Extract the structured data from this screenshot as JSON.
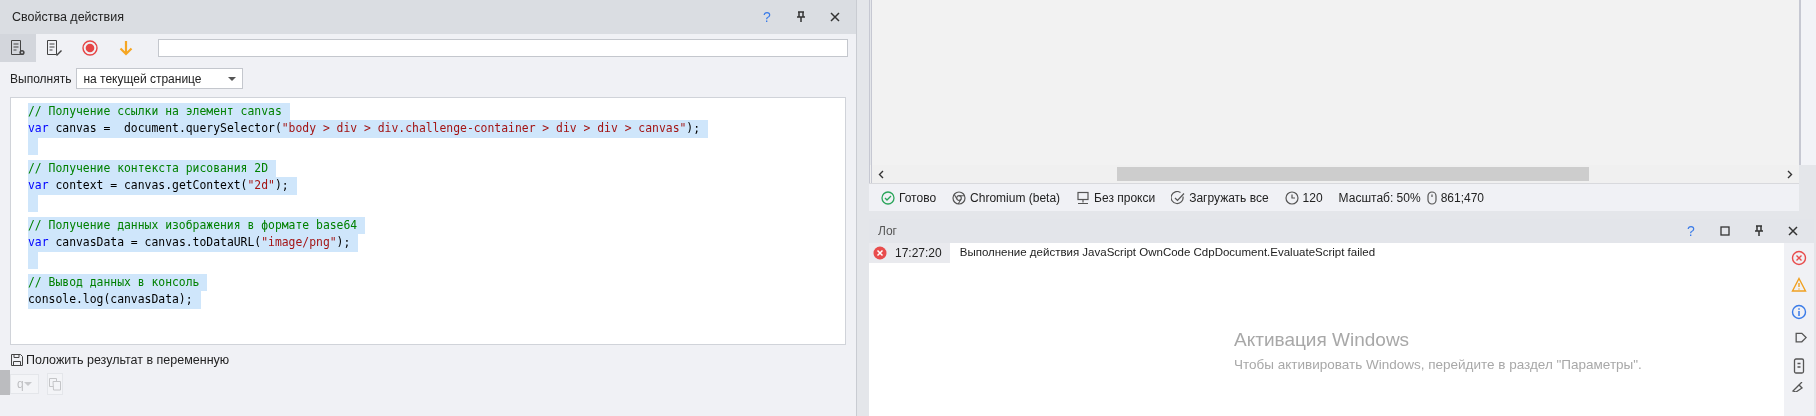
{
  "action_panel": {
    "title": "Свойства действия",
    "header_buttons": [
      {
        "kind": "help",
        "text": "?"
      },
      {
        "kind": "pin"
      },
      {
        "kind": "close"
      }
    ],
    "toolbar": [
      {
        "kind": "settings",
        "selected": true
      },
      {
        "kind": "edit",
        "selected": false
      },
      {
        "kind": "record",
        "selected": false
      },
      {
        "kind": "down",
        "selected": false
      }
    ],
    "execute_label": "Выполнять",
    "execute_value": "на текущей странице",
    "code_lines": [
      {
        "selected": true,
        "tokens": [
          {
            "kind": "comment",
            "text": "// Получение ссылки на элемент canvas"
          }
        ]
      },
      {
        "selected": true,
        "tokens": [
          {
            "kind": "keyword",
            "text": "var"
          },
          {
            "kind": "plain",
            "text": " canvas =  document.querySelector("
          },
          {
            "kind": "string",
            "text": "\"body > div > div.challenge-container > div > div > canvas\""
          },
          {
            "kind": "plain",
            "text": ");"
          }
        ]
      },
      {
        "selected": true
      },
      {
        "selected": true,
        "tokens": [
          {
            "kind": "comment",
            "text": "// Получение контекста рисования 2D"
          }
        ]
      },
      {
        "selected": true,
        "tokens": [
          {
            "kind": "keyword",
            "text": "var"
          },
          {
            "kind": "plain",
            "text": " context = canvas.getContext("
          },
          {
            "kind": "string",
            "text": "\"2d\""
          },
          {
            "kind": "plain",
            "text": ");"
          }
        ]
      },
      {
        "selected": true
      },
      {
        "selected": true,
        "tokens": [
          {
            "kind": "comment",
            "text": "// Получение данных изображения в формате base64"
          }
        ]
      },
      {
        "selected": true,
        "tokens": [
          {
            "kind": "keyword",
            "text": "var"
          },
          {
            "kind": "plain",
            "text": " canvasData = canvas.toDataURL("
          },
          {
            "kind": "string",
            "text": "\"image/png\""
          },
          {
            "kind": "plain",
            "text": ");"
          }
        ]
      },
      {
        "selected": true
      },
      {
        "selected": true,
        "tokens": [
          {
            "kind": "comment",
            "text": "// Вывод данных в консоль"
          }
        ]
      },
      {
        "selected": true,
        "tokens": [
          {
            "kind": "plain",
            "text": "console.log(canvasData);"
          }
        ]
      }
    ],
    "save_label": "Положить результат в переменную",
    "variable_value": "q"
  },
  "status_bar": [
    {
      "kind": "ready",
      "text": "Готово"
    },
    {
      "kind": "browser",
      "text": "Chromium (beta)"
    },
    {
      "kind": "proxy",
      "text": "Без прокси"
    },
    {
      "kind": "load",
      "text": "Загружать все"
    },
    {
      "kind": "timeout",
      "text": "120"
    },
    {
      "kind": "zoom",
      "text": "Масштаб: 50%"
    },
    {
      "kind": "cursor",
      "text": "861;470"
    }
  ],
  "log_panel": {
    "title": "Лог",
    "header_buttons": [
      {
        "kind": "help",
        "text": "?"
      },
      {
        "kind": "maximize"
      },
      {
        "kind": "pin"
      },
      {
        "kind": "close"
      }
    ],
    "entries": [
      {
        "kind": "error",
        "time": "17:27:20",
        "message": "Выполнение действия JavaScript OwnCode CdpDocument.EvaluateScript failed"
      }
    ],
    "filters": [
      {
        "kind": "error"
      },
      {
        "kind": "warning"
      },
      {
        "kind": "info"
      },
      {
        "kind": "tag"
      },
      {
        "kind": "phone"
      },
      {
        "kind": "broom"
      }
    ]
  },
  "os_watermark": {
    "title": "Активация Windows",
    "text": "Чтобы активировать Windows, перейдите в раздел \"Параметры\"."
  }
}
